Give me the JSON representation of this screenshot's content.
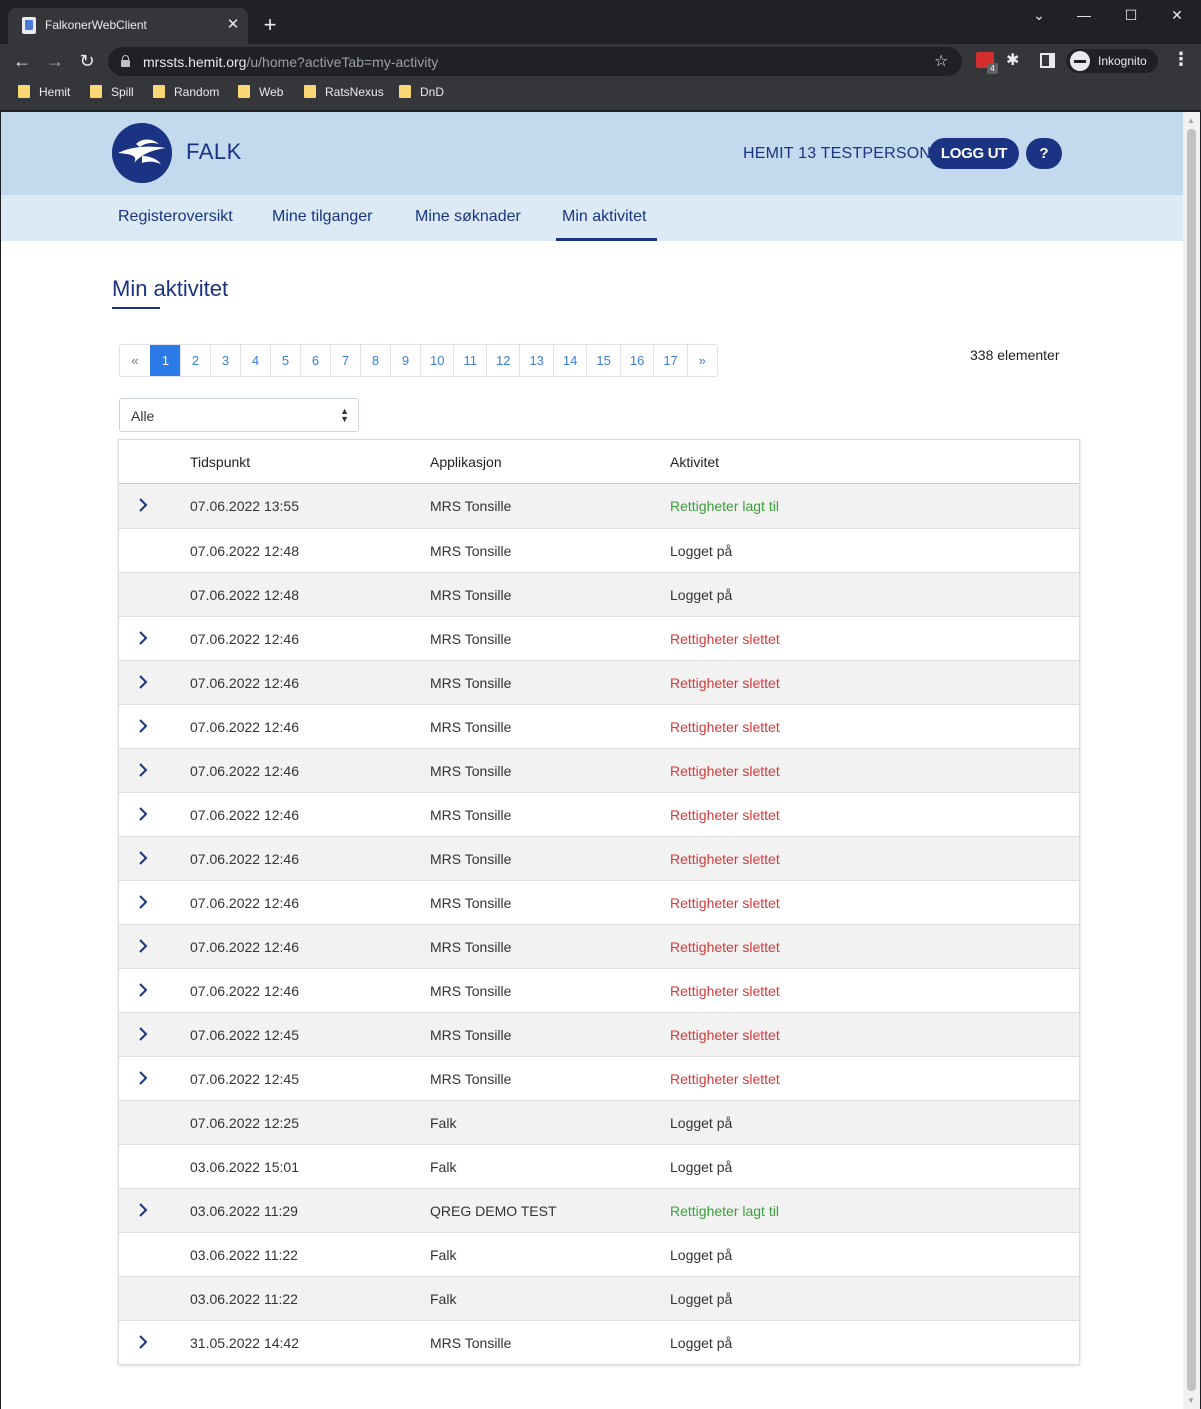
{
  "browser": {
    "tab_title": "FalkonerWebClient",
    "url_host": "mrssts.hemit.org",
    "url_path": "/u/home?activeTab=my-activity",
    "profile_label": "Inkognito",
    "extension_badge": "4",
    "bookmarks": [
      "Hemit",
      "Spill",
      "Random",
      "Web",
      "RatsNexus",
      "DnD"
    ]
  },
  "header": {
    "brand": "FALK",
    "user_name": "HEMIT 13 TESTPERSON",
    "logout_label": "LOGG UT",
    "help_label": "?"
  },
  "nav": {
    "items": [
      "Registeroversikt",
      "Mine tilganger",
      "Mine søknader",
      "Min aktivitet"
    ],
    "active": "Min aktivitet"
  },
  "page": {
    "title": "Min aktivitet",
    "total_count": "338 elementer"
  },
  "pagination": {
    "prev": "«",
    "pages": [
      "1",
      "2",
      "3",
      "4",
      "5",
      "6",
      "7",
      "8",
      "9",
      "10",
      "11",
      "12",
      "13",
      "14",
      "15",
      "16",
      "17"
    ],
    "next": "»",
    "current": "1"
  },
  "filter": {
    "selected": "Alle"
  },
  "table": {
    "columns": [
      "Tidspunkt",
      "Applikasjon",
      "Aktivitet"
    ],
    "rows": [
      {
        "time": "07.06.2022 13:55",
        "app": "MRS Tonsille",
        "activity": "Rettigheter lagt til",
        "type": "added",
        "expandable": true
      },
      {
        "time": "07.06.2022 12:48",
        "app": "MRS Tonsille",
        "activity": "Logget på",
        "type": "login",
        "expandable": false
      },
      {
        "time": "07.06.2022 12:48",
        "app": "MRS Tonsille",
        "activity": "Logget på",
        "type": "login",
        "expandable": false
      },
      {
        "time": "07.06.2022 12:46",
        "app": "MRS Tonsille",
        "activity": "Rettigheter slettet",
        "type": "deleted",
        "expandable": true
      },
      {
        "time": "07.06.2022 12:46",
        "app": "MRS Tonsille",
        "activity": "Rettigheter slettet",
        "type": "deleted",
        "expandable": true
      },
      {
        "time": "07.06.2022 12:46",
        "app": "MRS Tonsille",
        "activity": "Rettigheter slettet",
        "type": "deleted",
        "expandable": true
      },
      {
        "time": "07.06.2022 12:46",
        "app": "MRS Tonsille",
        "activity": "Rettigheter slettet",
        "type": "deleted",
        "expandable": true
      },
      {
        "time": "07.06.2022 12:46",
        "app": "MRS Tonsille",
        "activity": "Rettigheter slettet",
        "type": "deleted",
        "expandable": true
      },
      {
        "time": "07.06.2022 12:46",
        "app": "MRS Tonsille",
        "activity": "Rettigheter slettet",
        "type": "deleted",
        "expandable": true
      },
      {
        "time": "07.06.2022 12:46",
        "app": "MRS Tonsille",
        "activity": "Rettigheter slettet",
        "type": "deleted",
        "expandable": true
      },
      {
        "time": "07.06.2022 12:46",
        "app": "MRS Tonsille",
        "activity": "Rettigheter slettet",
        "type": "deleted",
        "expandable": true
      },
      {
        "time": "07.06.2022 12:46",
        "app": "MRS Tonsille",
        "activity": "Rettigheter slettet",
        "type": "deleted",
        "expandable": true
      },
      {
        "time": "07.06.2022 12:45",
        "app": "MRS Tonsille",
        "activity": "Rettigheter slettet",
        "type": "deleted",
        "expandable": true
      },
      {
        "time": "07.06.2022 12:45",
        "app": "MRS Tonsille",
        "activity": "Rettigheter slettet",
        "type": "deleted",
        "expandable": true
      },
      {
        "time": "07.06.2022 12:25",
        "app": "Falk",
        "activity": "Logget på",
        "type": "login",
        "expandable": false
      },
      {
        "time": "03.06.2022 15:01",
        "app": "Falk",
        "activity": "Logget på",
        "type": "login",
        "expandable": false
      },
      {
        "time": "03.06.2022 11:29",
        "app": "QREG DEMO TEST",
        "activity": "Rettigheter lagt til",
        "type": "added",
        "expandable": true
      },
      {
        "time": "03.06.2022 11:22",
        "app": "Falk",
        "activity": "Logget på",
        "type": "login",
        "expandable": false
      },
      {
        "time": "03.06.2022 11:22",
        "app": "Falk",
        "activity": "Logget på",
        "type": "login",
        "expandable": false
      },
      {
        "time": "31.05.2022 14:42",
        "app": "MRS Tonsille",
        "activity": "Logget på",
        "type": "login",
        "expandable": true
      }
    ]
  },
  "colors": {
    "brand_blue": "#1a3483",
    "header_bg": "#c3d9ee",
    "nav_bg": "#dceaf6",
    "added": "#3aa03a",
    "deleted": "#d9383a",
    "pagination_active": "#2c7ae8"
  }
}
